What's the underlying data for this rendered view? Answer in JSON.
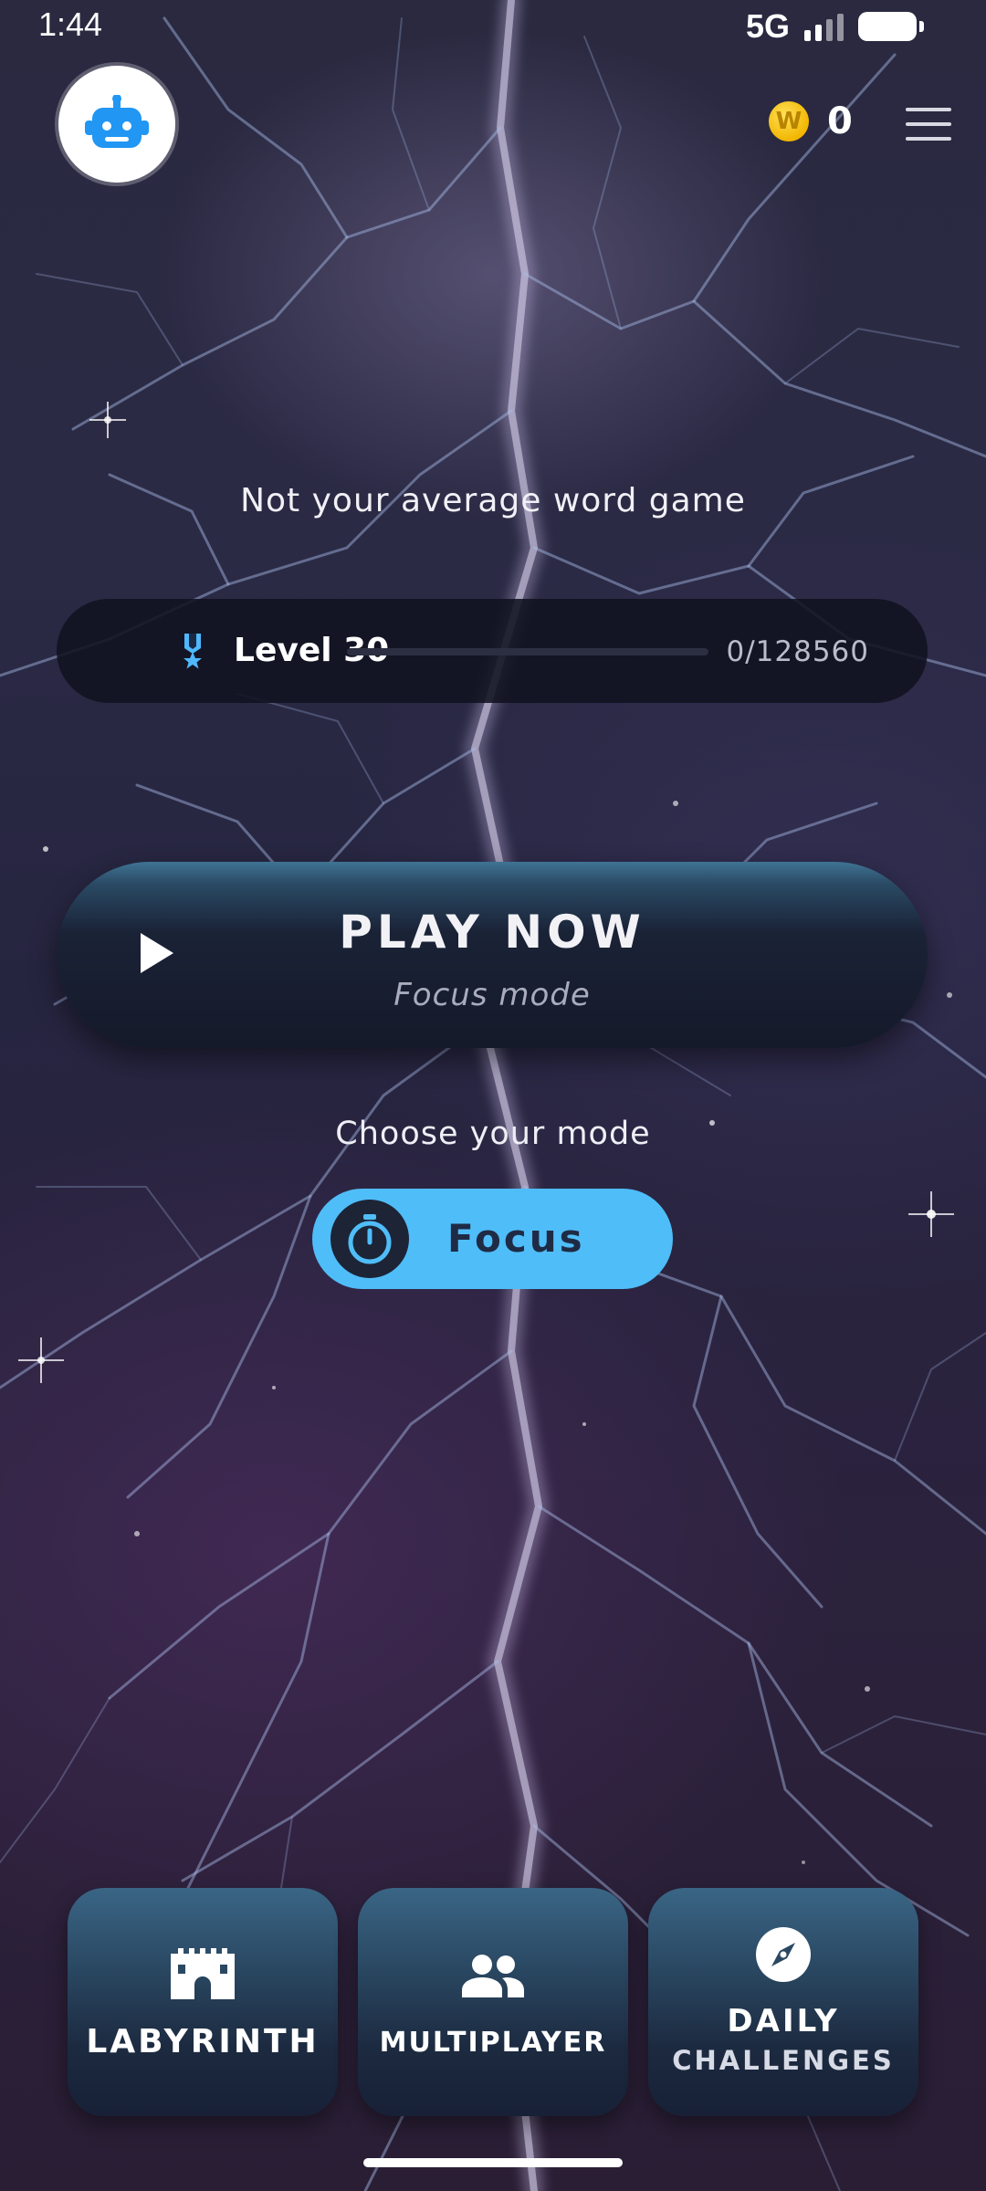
{
  "status_bar": {
    "time": "1:44",
    "network": "5G"
  },
  "header": {
    "avatar_icon": "robot-icon",
    "coin_symbol": "W",
    "coin_count": "0",
    "menu_icon": "hamburger-menu-icon"
  },
  "tagline": "Not your average word game",
  "level": {
    "label": "Level 30",
    "points": "0/128560",
    "progress_fraction": 0.0,
    "icon": "medal-icon"
  },
  "play": {
    "title": "PLAY NOW",
    "subtitle": "Focus mode",
    "icon": "play-icon"
  },
  "mode": {
    "prompt": "Choose your mode",
    "selected": "Focus",
    "icon": "stopwatch-icon"
  },
  "cards": [
    {
      "label": "LABYRINTH",
      "icon": "castle-icon"
    },
    {
      "label": "MULTIPLAYER",
      "icon": "people-icon"
    },
    {
      "label_line1": "DAILY",
      "label_line2": "CHALLENGES",
      "icon": "compass-icon"
    }
  ],
  "colors": {
    "accent": "#4fbdf8",
    "coin": "#f2b600",
    "avatar_icon": "#2196f3"
  }
}
